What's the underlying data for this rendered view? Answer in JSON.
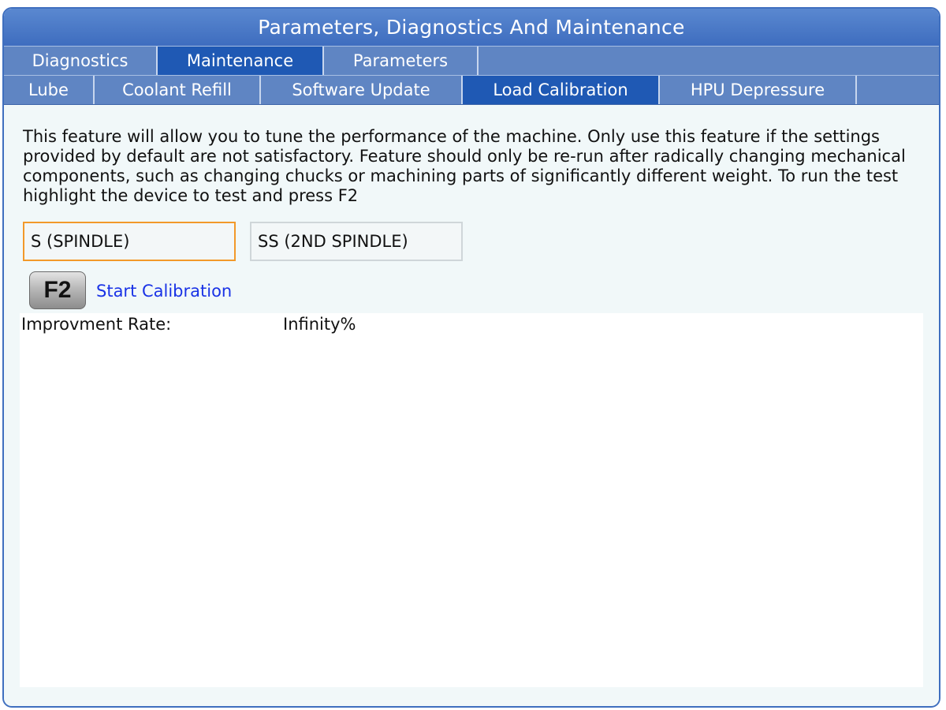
{
  "window": {
    "title": "Parameters, Diagnostics And Maintenance"
  },
  "main_tabs": [
    {
      "label": "Diagnostics",
      "active": false
    },
    {
      "label": "Maintenance",
      "active": true
    },
    {
      "label": "Parameters",
      "active": false
    }
  ],
  "sub_tabs": [
    {
      "label": "Lube",
      "active": false
    },
    {
      "label": "Coolant Refill",
      "active": false
    },
    {
      "label": "Software Update",
      "active": false
    },
    {
      "label": "Load Calibration",
      "active": true
    },
    {
      "label": "HPU Depressure",
      "active": false
    }
  ],
  "description": "This feature will allow you to tune the performance of the machine. Only use this feature if the settings provided by default are not satisfactory. Feature should only be re-run after radically changing mechanical components, such as changing chucks or machining parts of significantly different weight. To run the test highlight the device to test and press F2",
  "devices": [
    {
      "label": "S (SPINDLE)",
      "selected": true
    },
    {
      "label": "SS (2ND SPINDLE)",
      "selected": false
    }
  ],
  "action": {
    "key": "F2",
    "label": "Start Calibration"
  },
  "results": {
    "improvement_label": "Improvment Rate:",
    "improvement_value": "Infinity%"
  },
  "colors": {
    "title_bar": "#3e6dbf",
    "tab_bar": "#5f85c3",
    "active_tab": "#1f59b4",
    "selected_outline": "#f2992a",
    "link_text": "#1a33e6"
  }
}
